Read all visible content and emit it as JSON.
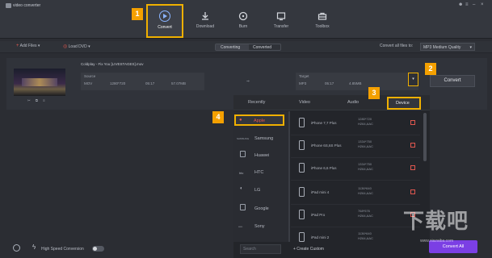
{
  "app": {
    "title": "video converter"
  },
  "nav": [
    {
      "label": "Convert",
      "icon": "convert-icon"
    },
    {
      "label": "Download",
      "icon": "download-icon"
    },
    {
      "label": "Burn",
      "icon": "burn-icon"
    },
    {
      "label": "Transfer",
      "icon": "transfer-icon"
    },
    {
      "label": "Toolbox",
      "icon": "toolbox-icon"
    }
  ],
  "window_controls": [
    "user-icon",
    "menu-icon",
    "minimize-icon",
    "close-icon"
  ],
  "toolbar": {
    "add_files": "Add Files",
    "load_dvd": "Load DVD",
    "seg_converting": "Converting",
    "seg_converted": "Converted",
    "convert_all_label": "Convert all files to:",
    "quality": "MP3 Medium Quality"
  },
  "file": {
    "name": "Coldplay - Fix You [LIVESTAGES].mov",
    "source_label": "Source",
    "source_format": "MOV",
    "source_res": "1280*720",
    "source_dur": "05:17",
    "source_size": "57.07MB",
    "target_label": "Target",
    "target_format": "MP3",
    "target_dur": "05:17",
    "target_size": "4.85MB",
    "convert_button": "Convert"
  },
  "badges": {
    "b1": "1",
    "b2": "2",
    "b3": "3",
    "b4": "4"
  },
  "panel": {
    "tabs": [
      "Recently",
      "Video",
      "Audio",
      "Device"
    ],
    "brands": [
      "Apple",
      "Samsung",
      "Huawei",
      "HTC",
      "LG",
      "Google",
      "Sony"
    ],
    "devices": [
      {
        "name": "iPhone 7,7 Plus",
        "res": "1280*720",
        "codec": "H264,AAC"
      },
      {
        "name": "iPhone 6S,6S Plus",
        "res": "1334*750",
        "codec": "H264,AAC"
      },
      {
        "name": "iPhone 6,6 Plus",
        "res": "1334*750",
        "codec": "H264,AAC"
      },
      {
        "name": "iPad mini 4",
        "res": "1136*640",
        "codec": "H264,AAC"
      },
      {
        "name": "iPad Pro",
        "res": "768*576",
        "codec": "H264,AAC"
      },
      {
        "name": "iPad mini 2",
        "res": "1136*640",
        "codec": "H264,AAC"
      }
    ],
    "search_placeholder": "Search",
    "create_custom": "+ Create Custom"
  },
  "bottom": {
    "high_speed": "High Speed Conversion",
    "convert_all": "Convert All"
  },
  "watermark": {
    "text": "下载吧",
    "sub": "www.xiazaiba.com"
  }
}
